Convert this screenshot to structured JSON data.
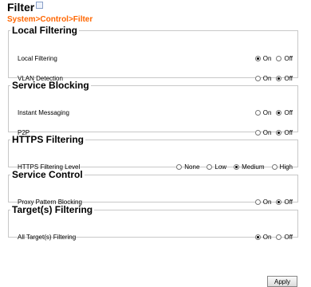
{
  "header": {
    "title": "Filter",
    "breadcrumb": "System>Control>Filter"
  },
  "sections": {
    "local_filtering": {
      "title": "Local Filtering",
      "rows": [
        {
          "label": "Local Filtering",
          "options": [
            "On",
            "Off"
          ],
          "selected": "On"
        },
        {
          "label": "VLAN Detection",
          "options": [
            "On",
            "Off"
          ],
          "selected": "Off"
        }
      ]
    },
    "service_blocking": {
      "title": "Service Blocking",
      "rows": [
        {
          "label": "Instant Messaging",
          "options": [
            "On",
            "Off"
          ],
          "selected": "Off"
        },
        {
          "label": "P2P",
          "options": [
            "On",
            "Off"
          ],
          "selected": "Off"
        }
      ]
    },
    "https_filtering": {
      "title": "HTTPS Filtering",
      "rows": [
        {
          "label": "HTTPS Filtering Level",
          "options": [
            "None",
            "Low",
            "Medium",
            "High"
          ],
          "selected": "Medium"
        }
      ]
    },
    "service_control": {
      "title": "Service Control",
      "rows": [
        {
          "label": "Proxy Pattern Blocking",
          "options": [
            "On",
            "Off"
          ],
          "selected": "Off"
        }
      ]
    },
    "targets_filtering": {
      "title": "Target(s) Filtering",
      "rows": [
        {
          "label": "All Target(s) Filtering",
          "options": [
            "On",
            "Off"
          ],
          "selected": "On"
        }
      ]
    }
  },
  "footer": {
    "apply_label": "Apply"
  }
}
